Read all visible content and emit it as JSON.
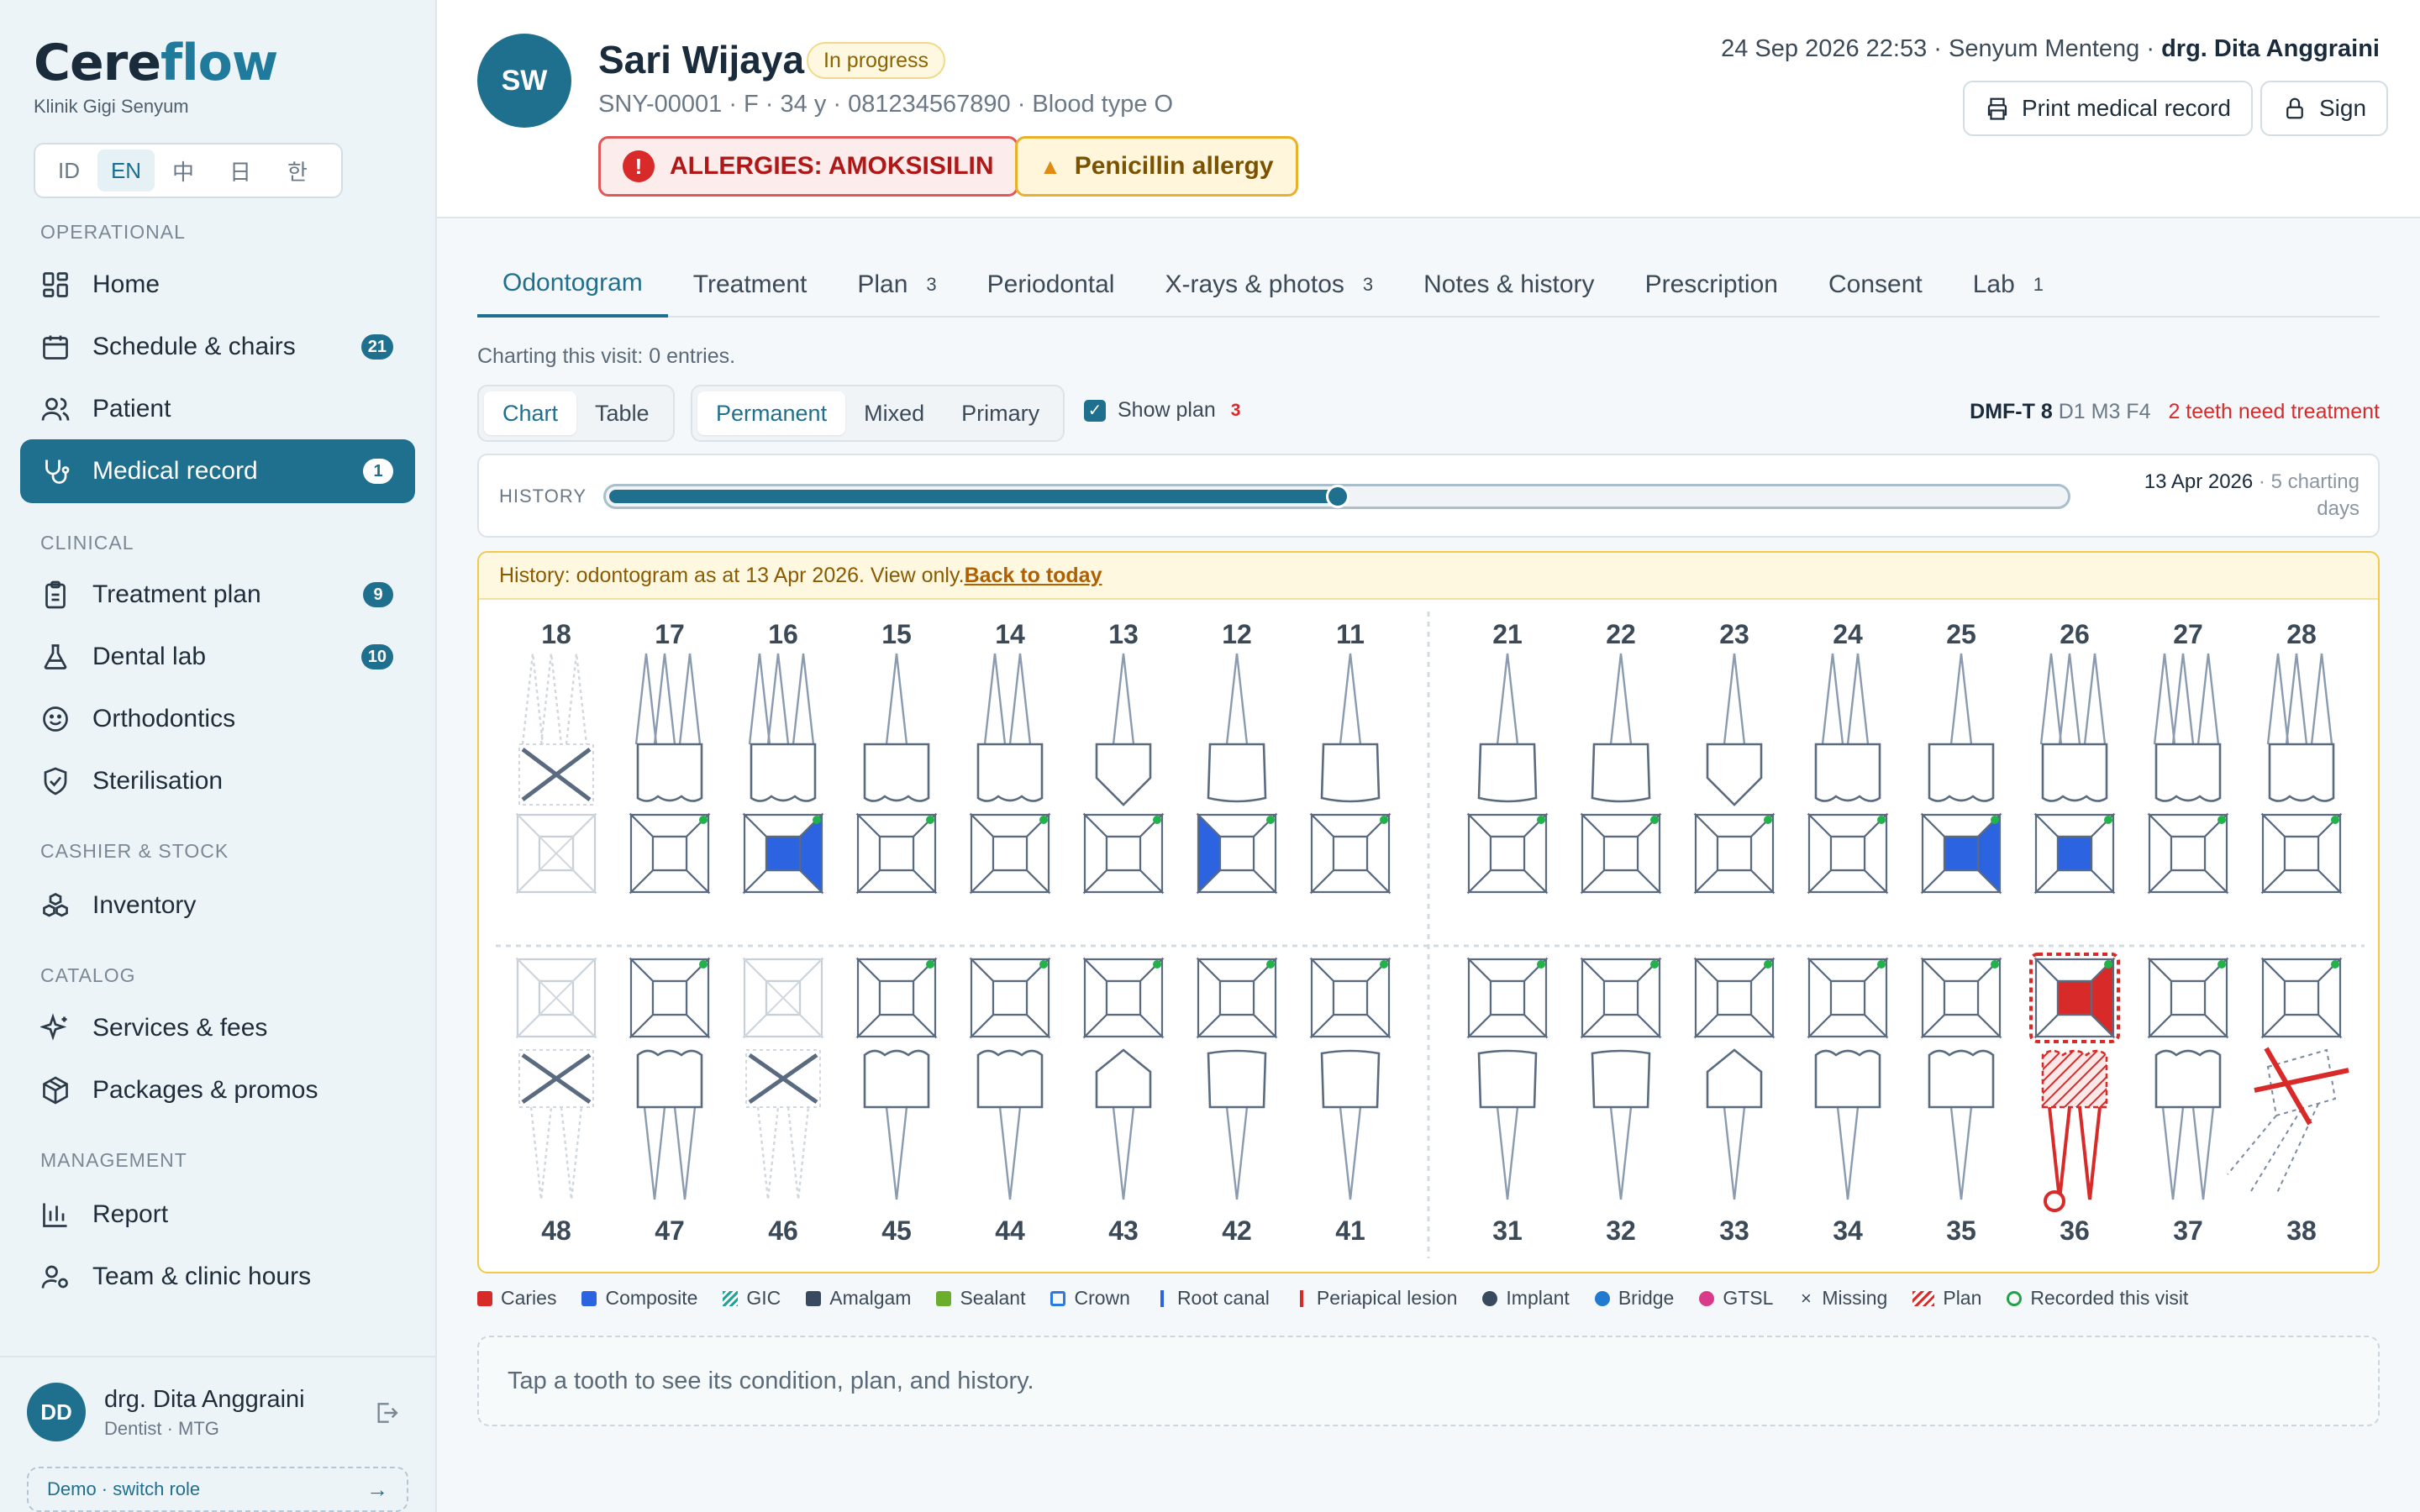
{
  "brand": {
    "name_a": "Cere",
    "name_b": "flow",
    "clinic": "Klinik Gigi Senyum"
  },
  "languages": [
    "ID",
    "EN",
    "中",
    "日",
    "한"
  ],
  "nav": {
    "sections": {
      "operational": "OPERATIONAL",
      "clinical": "CLINICAL",
      "cashier": "CASHIER & STOCK",
      "catalog": "CATALOG",
      "management": "MANAGEMENT"
    },
    "items": [
      {
        "label": "Home",
        "icon": "home-grid-icon"
      },
      {
        "label": "Schedule & chairs",
        "icon": "calendar-icon",
        "badge": "21"
      },
      {
        "label": "Patient",
        "icon": "users-icon"
      },
      {
        "label": "Medical record",
        "icon": "stethoscope-icon",
        "badge": "1"
      },
      {
        "label": "Treatment plan",
        "icon": "clipboard-icon",
        "badge": "9"
      },
      {
        "label": "Dental lab",
        "icon": "flask-icon",
        "badge": "10"
      },
      {
        "label": "Orthodontics",
        "icon": "smile-icon"
      },
      {
        "label": "Sterilisation",
        "icon": "shield-check-icon"
      },
      {
        "label": "Inventory",
        "icon": "boxes-icon"
      },
      {
        "label": "Services & fees",
        "icon": "sparkles-icon"
      },
      {
        "label": "Packages & promos",
        "icon": "package-icon"
      },
      {
        "label": "Report",
        "icon": "bar-chart-icon"
      },
      {
        "label": "Team & clinic hours",
        "icon": "user-cog-icon"
      }
    ]
  },
  "user": {
    "initials": "DD",
    "name": "drg. Dita Anggraini",
    "role": "Dentist · MTG",
    "demo": "Demo · switch role",
    "demo_arrow": "→"
  },
  "patient": {
    "initials": "SW",
    "name": "Sari Wijaya",
    "status": "In progress",
    "meta": "SNY-00001 · F · 34 y · 081234567890 · Blood type O",
    "allergy": "ALLERGIES: AMOKSISILIN",
    "warning": "Penicillin allergy"
  },
  "header": {
    "datetime": "24 Sep 2026 22:53 · Senyum Menteng · ",
    "doctor": "drg. Dita Anggraini",
    "print": "Print medical record",
    "sign": "Sign"
  },
  "tabs": [
    {
      "label": "Odontogram"
    },
    {
      "label": "Treatment"
    },
    {
      "label": "Plan",
      "count": "3"
    },
    {
      "label": "Periodontal"
    },
    {
      "label": "X-rays & photos",
      "count": "3"
    },
    {
      "label": "Notes & history"
    },
    {
      "label": "Prescription"
    },
    {
      "label": "Consent"
    },
    {
      "label": "Lab",
      "count": "1"
    }
  ],
  "charting": {
    "note": "Charting this visit: 0 entries.",
    "view_modes": [
      "Chart",
      "Table"
    ],
    "dentition": [
      "Permanent",
      "Mixed",
      "Primary"
    ],
    "show_plan_label": "Show plan",
    "show_plan_count": "3",
    "show_plan_checked": true,
    "dmft_label": "DMF-T 8",
    "dmft_detail": "D1 M3 F4",
    "need_treatment": "2 teeth need treatment"
  },
  "history": {
    "label": "HISTORY",
    "position": 0.5,
    "date": "13 Apr 2026",
    "days": "5 charting",
    "days2": "days",
    "banner": "History: odontogram as at 13 Apr 2026. View only. ",
    "back": "Back to today"
  },
  "teeth": {
    "upper": [
      "18",
      "17",
      "16",
      "15",
      "14",
      "13",
      "12",
      "11",
      "21",
      "22",
      "23",
      "24",
      "25",
      "26",
      "27",
      "28"
    ],
    "lower": [
      "48",
      "47",
      "46",
      "45",
      "44",
      "43",
      "42",
      "41",
      "31",
      "32",
      "33",
      "34",
      "35",
      "36",
      "37",
      "38"
    ]
  },
  "legend": [
    {
      "label": "Caries",
      "color": "#d92a2a",
      "kind": "fill"
    },
    {
      "label": "Composite",
      "color": "#2c63e0",
      "kind": "fill"
    },
    {
      "label": "GIC",
      "color": "#1fa39a",
      "kind": "hatch"
    },
    {
      "label": "Amalgam",
      "color": "#3a4a5e",
      "kind": "fill"
    },
    {
      "label": "Sealant",
      "color": "#6aae2c",
      "kind": "fill"
    },
    {
      "label": "Crown",
      "color": "#2c7ae0",
      "kind": "ring"
    },
    {
      "label": "Root canal",
      "color": "#2c63e0",
      "kind": "bar"
    },
    {
      "label": "Periapical lesion",
      "color": "#d92a2a",
      "kind": "bar"
    },
    {
      "label": "Implant",
      "color": "#3a4a5e",
      "kind": "dot"
    },
    {
      "label": "Bridge",
      "color": "#1f7ad0",
      "kind": "dot"
    },
    {
      "label": "GTSL",
      "color": "#d93a8a",
      "kind": "dot"
    },
    {
      "label": "Missing",
      "color": "#3c4a58",
      "kind": "x"
    },
    {
      "label": "Plan",
      "color": "#d92a2a",
      "kind": "stripe"
    },
    {
      "label": "Recorded this visit",
      "color": "#22a34a",
      "kind": "circle"
    }
  ],
  "detail_hint": "Tap a tooth to see its condition, plan, and history."
}
